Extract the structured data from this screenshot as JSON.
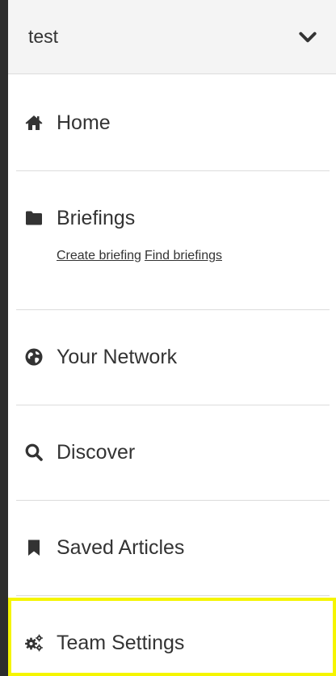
{
  "team_selector": {
    "value": "test",
    "icon": "chevron-down-icon"
  },
  "nav": {
    "home": {
      "label": "Home",
      "icon": "home-icon"
    },
    "briefings": {
      "label": "Briefings",
      "icon": "folder-icon",
      "links": {
        "create": "Create briefing",
        "find": "Find briefings"
      }
    },
    "network": {
      "label": "Your Network",
      "icon": "globe-icon"
    },
    "discover": {
      "label": "Discover",
      "icon": "search-icon"
    },
    "saved": {
      "label": "Saved Articles",
      "icon": "bookmark-icon"
    },
    "team_settings": {
      "label": "Team Settings",
      "icon": "gears-icon",
      "highlighted": true
    }
  },
  "colors": {
    "background": "#2d2d2d",
    "panel": "#ffffff",
    "text": "#333333",
    "highlight": "#f5f500"
  }
}
